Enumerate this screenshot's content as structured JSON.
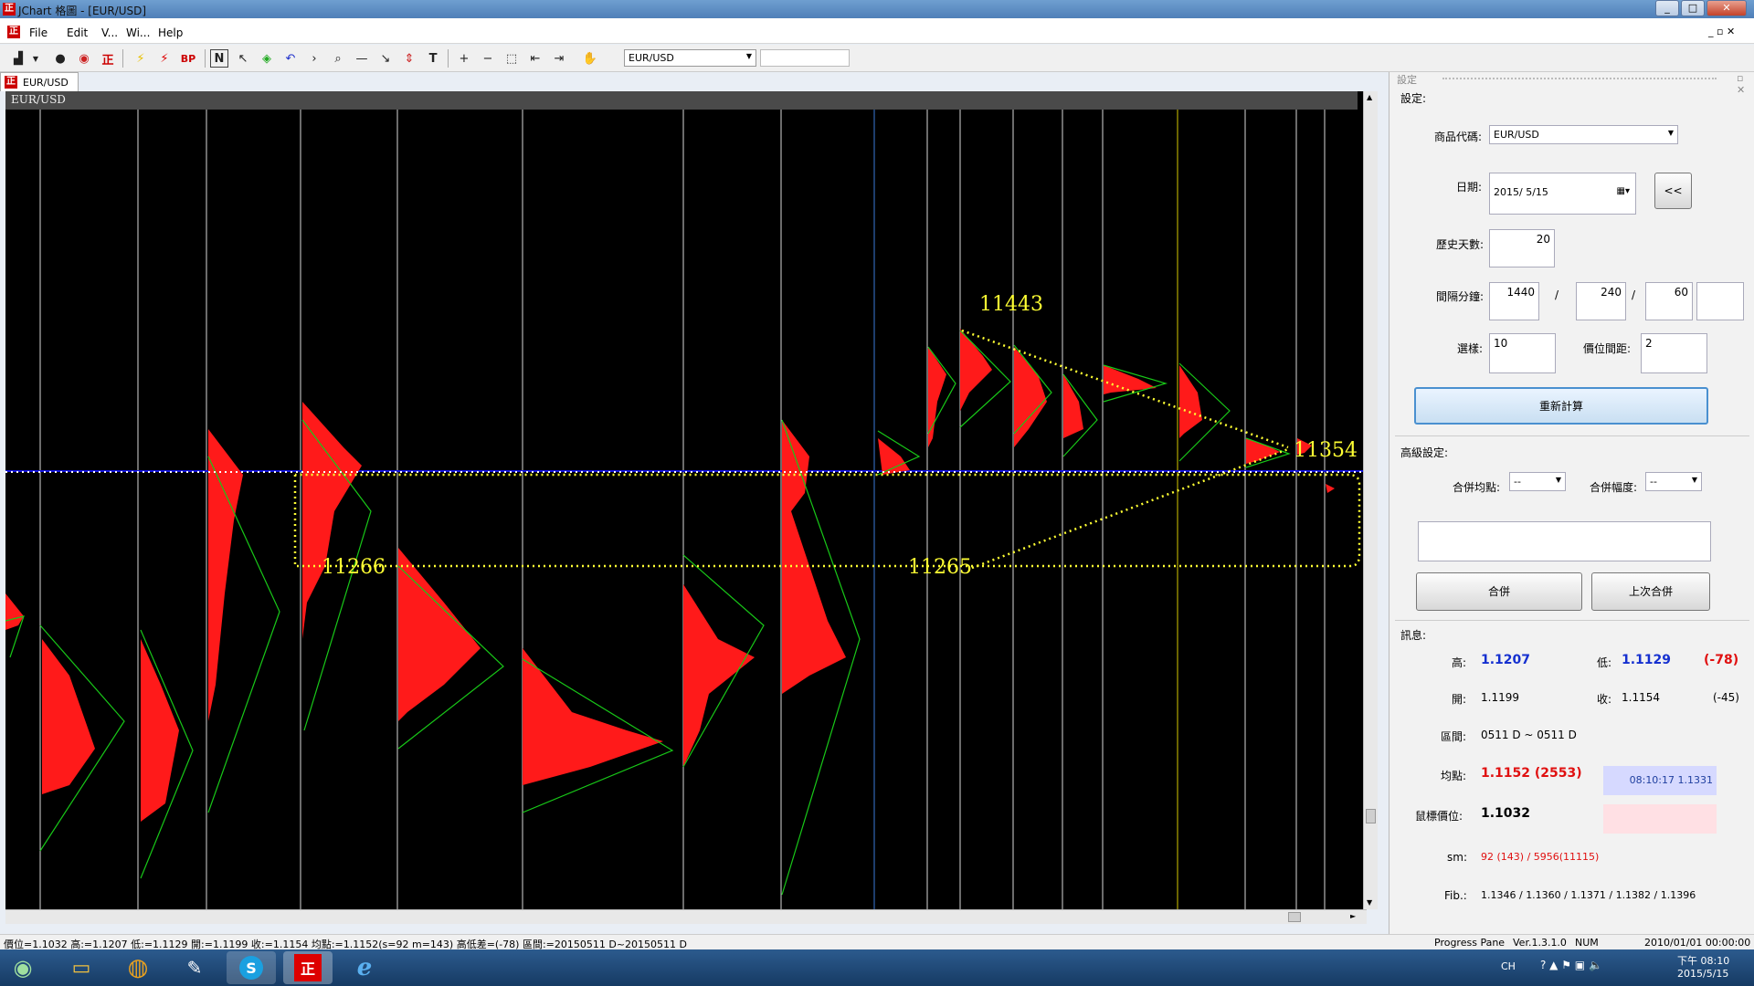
{
  "window": {
    "title": "JChart 格圖 - [EUR/USD]",
    "logo": "正",
    "controls": [
      "_",
      "□",
      "✕"
    ]
  },
  "menu": [
    "File",
    "Edit",
    "V...",
    "Wi...",
    "Help"
  ],
  "toolbar": {
    "symbol": "EUR/USD",
    "bp_label": "BP",
    "n_label": "N",
    "t_label": "T"
  },
  "doc_tab": "EUR/USD",
  "chart": {
    "header": "EUR/USD",
    "annotations": {
      "a": "11443",
      "b": "11354",
      "c": "11266",
      "d": "11265"
    }
  },
  "panel": {
    "title": "設定",
    "settings_label": "設定:",
    "symbol_label": "商品代碼:",
    "symbol_value": "EUR/USD",
    "date_label": "日期:",
    "date_value": "2015/  5/15",
    "back_button": "<<",
    "history_label": "歷史天數:",
    "history_value": "20",
    "interval_label": "間隔分鐘:",
    "interval_values": [
      "1440",
      "240",
      "60",
      ""
    ],
    "sep": "/",
    "choice_label": "選樣:",
    "choice_value": "10",
    "price_gap_label": "價位間距:",
    "price_gap_value": "2",
    "recalc_button": "重新計算",
    "advanced_label": "高級設定:",
    "merge_avg_label": "合併均點:",
    "merge_avg_value": "--",
    "merge_range_label": "合併幅度:",
    "merge_range_value": "--",
    "merge_button": "合併",
    "last_merge_button": "上次合併",
    "info_label": "訊息:",
    "high_label": "高:",
    "high_value": "1.1207",
    "low_label": "低:",
    "low_value": "1.1129",
    "low_diff": "(-78)",
    "open_label": "開:",
    "open_value": "1.1199",
    "close_label": "收:",
    "close_value": "1.1154",
    "close_diff": "(-45)",
    "range_label": "區間:",
    "range_value": "0511 D ~ 0511 D",
    "avg_label": "均點:",
    "avg_value": "1.1152 (2553)",
    "time_box": "08:10:17  1.1331",
    "mouse_label": "鼠標價位:",
    "mouse_value": "1.1032",
    "sm_label": "sm:",
    "sm_value": "92 (143) / 5956(11115)",
    "fib_label": "Fib.:",
    "fib_value": "1.1346 / 1.1360 / 1.1371 / 1.1382 / 1.1396"
  },
  "status": {
    "left": "價位=1.1032  高:=1.1207  低:=1.1129  開:=1.1199  收:=1.1154  均點:=1.1152(s=92 m=143)  高低差=(-78)  區間:=20150511 D~20150511 D",
    "progress": "Progress Pane",
    "version": "Ver.1.3.1.0",
    "num": "NUM",
    "datetime": "2010/01/01 00:00:00"
  },
  "taskbar": {
    "lang": "CH",
    "time": "下午 08:10",
    "date": "2015/5/15",
    "skype": "S",
    "app": "正"
  },
  "colors": {
    "profile": "#ff1a1a",
    "green_line": "#18c818",
    "blue_line": "#1010d0",
    "yellow": "#ffff33",
    "grid": "#ffffff"
  }
}
